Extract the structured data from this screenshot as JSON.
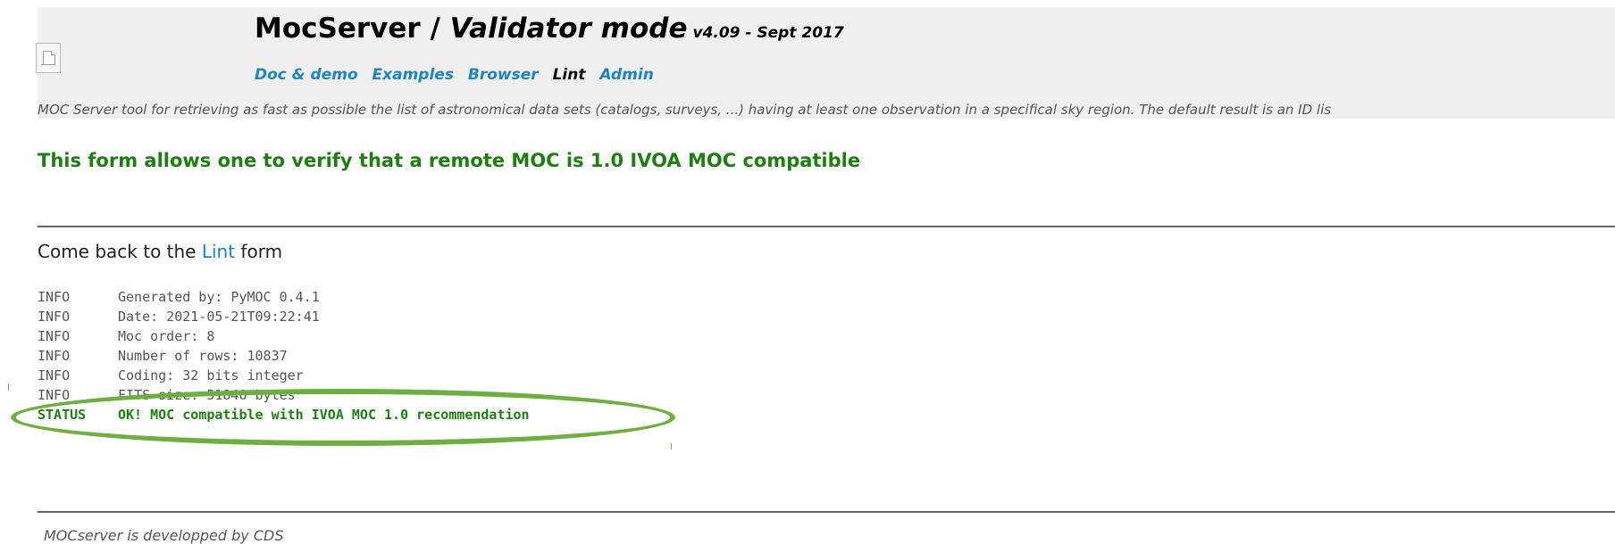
{
  "header": {
    "title_main": "MocServer / ",
    "title_mode": "Validator mode",
    "version": "v4.09 - Sept 2017",
    "logo_icon": "broken-image-icon",
    "nav": [
      {
        "label": "Doc & demo",
        "current": false
      },
      {
        "label": "Examples",
        "current": false
      },
      {
        "label": "Browser",
        "current": false
      },
      {
        "label": "Lint",
        "current": true
      },
      {
        "label": "Admin",
        "current": false
      }
    ]
  },
  "description": "MOC Server tool for retrieving as fast as possible the list of astronomical data sets (catalogs, surveys, ...) having at least one observation in a specifical sky region. The default result is an ID lis",
  "form_heading": "This form allows one to verify that a remote MOC is 1.0 IVOA MOC compatible",
  "back_line": {
    "prefix": "Come back to the ",
    "link": "Lint",
    "suffix": " form"
  },
  "log": [
    {
      "level": "INFO",
      "message": "Generated by: PyMOC 0.4.1"
    },
    {
      "level": "INFO",
      "message": "Date: 2021-05-21T09:22:41"
    },
    {
      "level": "INFO",
      "message": "Moc order: 8"
    },
    {
      "level": "INFO",
      "message": "Number of rows: 10837"
    },
    {
      "level": "INFO",
      "message": "Coding: 32 bits integer"
    },
    {
      "level": "INFO",
      "message": "FITS size: 51840 bytes"
    },
    {
      "level": "STATUS",
      "message": "OK! MOC compatible with IVOA MOC 1.0 recommendation"
    }
  ],
  "footer": "MOCserver is developped by CDS",
  "colors": {
    "header_bg": "#efefef",
    "link": "#1f84c5",
    "green": "#1e7e12",
    "highlight": "#6fae43"
  }
}
